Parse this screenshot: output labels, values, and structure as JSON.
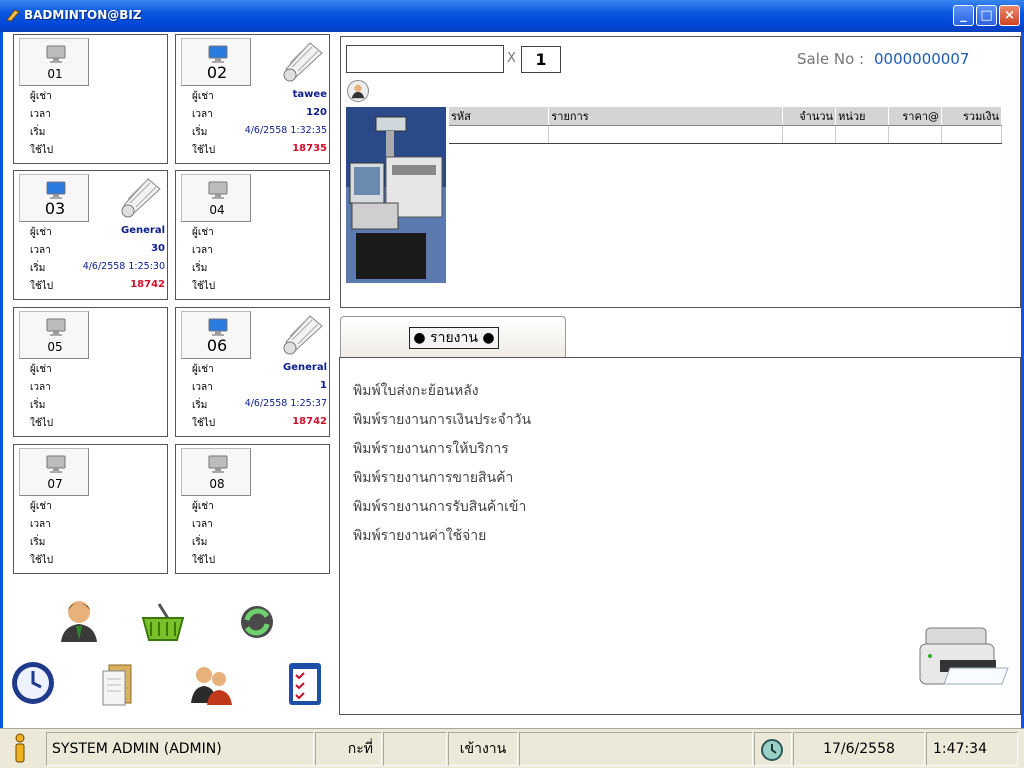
{
  "window": {
    "title": "BADMINTON@BIZ"
  },
  "labels": {
    "renter": "ผู้เช่า",
    "time": "เวลา",
    "start": "เริ่ม",
    "used": "ใช้ไป"
  },
  "courts": [
    {
      "number": "01",
      "active": false,
      "renter": "",
      "time": "",
      "start": "",
      "used": ""
    },
    {
      "number": "02",
      "active": true,
      "renter": "tawee",
      "time": "120",
      "start": "4/6/2558 1:32:35",
      "used": "18735"
    },
    {
      "number": "03",
      "active": true,
      "renter": "General",
      "time": "30",
      "start": "4/6/2558 1:25:30",
      "used": "18742"
    },
    {
      "number": "04",
      "active": false,
      "renter": "",
      "time": "",
      "start": "",
      "used": ""
    },
    {
      "number": "05",
      "active": false,
      "renter": "",
      "time": "",
      "start": "",
      "used": ""
    },
    {
      "number": "06",
      "active": true,
      "renter": "General",
      "time": "1",
      "start": "4/6/2558 1:25:37",
      "used": "18742"
    },
    {
      "number": "07",
      "active": false,
      "renter": "",
      "time": "",
      "start": "",
      "used": ""
    },
    {
      "number": "08",
      "active": false,
      "renter": "",
      "time": "",
      "start": "",
      "used": ""
    }
  ],
  "tools": [
    "customer-icon",
    "basket-icon",
    "refresh-icon",
    "clock-icon",
    "folder-icon",
    "users-icon",
    "checklist-icon"
  ],
  "sale": {
    "qty_x": "X",
    "qty": "1",
    "sale_no_label": "Sale No :",
    "sale_no": "0000000007",
    "columns": [
      "รหัส",
      "รายการ",
      "จำนวน",
      "หน่วย",
      "ราคา@",
      "รวมเงิน"
    ]
  },
  "report": {
    "tab_label": "● รายงาน ●",
    "items": [
      "พิมพ์ใบส่งกะย้อนหลัง",
      "พิมพ์รายงานการเงินประจำวัน",
      "พิมพ์รายงานการให้บริการ",
      "พิมพ์รายงานการขายสินค้า",
      "พิมพ์รายงานการรับสินค้าเข้า",
      "พิมพ์รายงานค่าใช้จ่าย"
    ]
  },
  "status": {
    "user": "SYSTEM ADMIN (ADMIN)",
    "shift_label": "กะที่",
    "shift_value": "",
    "login_label": "เข้างาน",
    "login_value": "",
    "date": "17/6/2558",
    "time": "1:47:34"
  },
  "colors": {
    "titlebar": "#0a56e0",
    "value_blue": "#0b1e8c",
    "value_red": "#d0102a",
    "sale_no": "#1e5bb5"
  }
}
